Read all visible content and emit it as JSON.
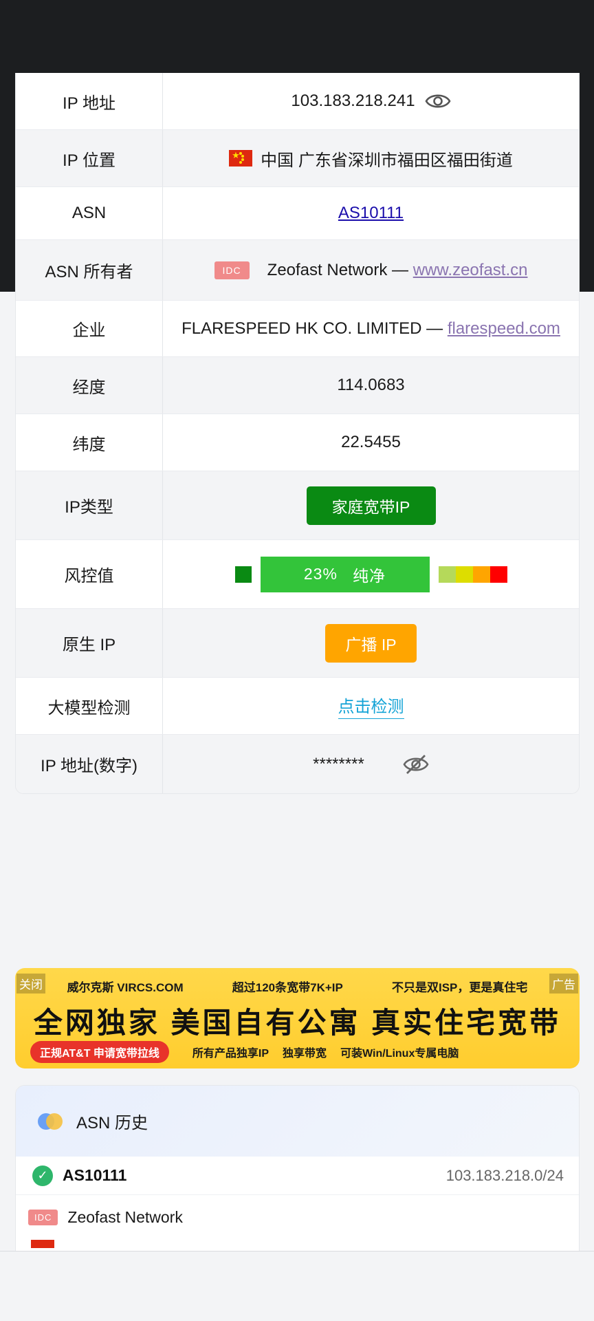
{
  "rows": [
    {
      "label": "IP 地址",
      "value": "103.183.218.241"
    },
    {
      "label": "IP 位置",
      "value": "中国 广东省深圳市福田区福田街道"
    },
    {
      "label": "ASN",
      "value": "AS10111"
    },
    {
      "label": "ASN 所有者",
      "tag": "IDC",
      "name": "Zeofast Network —",
      "link": "www.zeofast.cn"
    },
    {
      "label": "企业",
      "name": "FLARESPEED HK CO. LIMITED —",
      "link": "flarespeed.com"
    },
    {
      "label": "经度",
      "value": "114.0683"
    },
    {
      "label": "纬度",
      "value": "22.5455"
    },
    {
      "label": "IP类型",
      "value": "家庭宽带IP"
    },
    {
      "label": "风控值",
      "percent": "23%",
      "text": "纯净"
    },
    {
      "label": "原生 IP",
      "value": "广播 IP"
    },
    {
      "label": "大模型检测",
      "value": "点击检测"
    },
    {
      "label": "IP 地址(数字)",
      "value": "********"
    }
  ],
  "risk": {
    "score": 0.23,
    "colors": [
      "#0a8a13",
      "#33c43a",
      "#b5d95a",
      "#dddd00",
      "#ffa500",
      "#ff0000"
    ]
  },
  "banner": {
    "close": "关闭",
    "ad": "广告",
    "line1": [
      "威尔克斯 VIRCS.COM",
      "超过120条宽带7K+IP",
      "不只是双ISP，更是真住宅"
    ],
    "headline": "全网独家 美国自有公寓 真实住宅宽带",
    "pill": "正规AT&T 申请宽带拉线",
    "line3": [
      "所有产品独享IP",
      "独享带宽",
      "可装Win/Linux专属电脑"
    ]
  },
  "asn_history": {
    "title": "ASN 历史",
    "asn": "AS10111",
    "prefix": "103.183.218.0/24",
    "tag": "IDC",
    "owner": "Zeofast Network"
  }
}
